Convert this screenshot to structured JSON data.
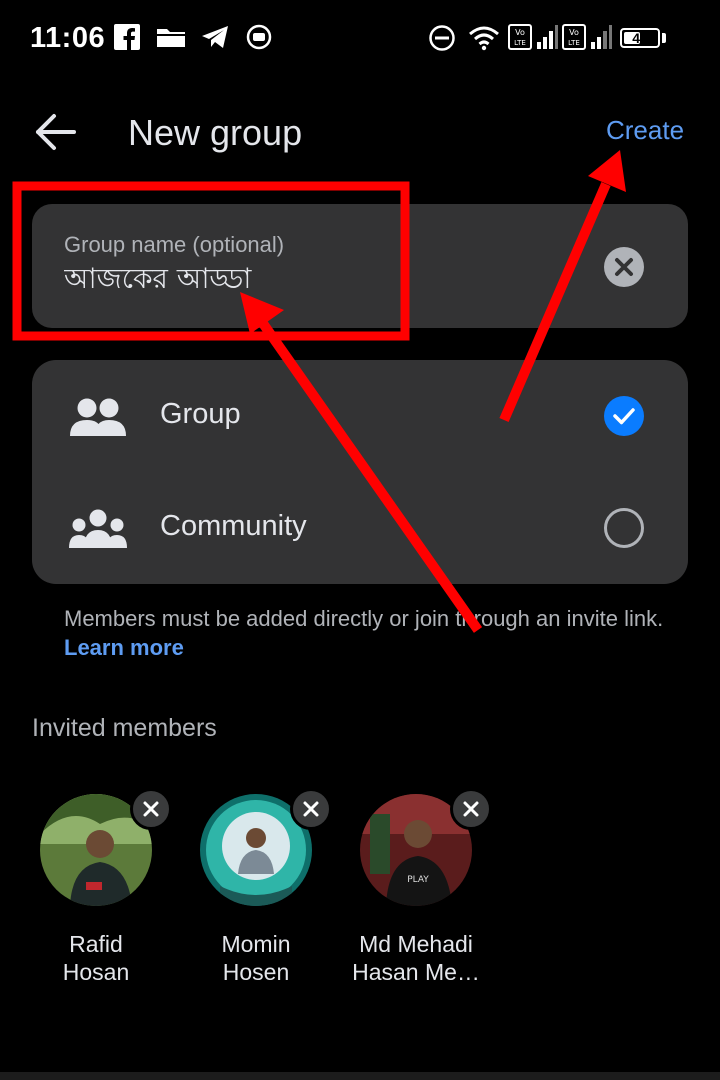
{
  "status_bar": {
    "time": "11:06",
    "battery": "49",
    "battery_level": 0.49,
    "icons": [
      "facebook-icon",
      "folder-icon",
      "telegram-icon",
      "record-icon",
      "do-not-disturb-icon",
      "wifi-icon",
      "volte-icon",
      "signal-icon",
      "volte-icon",
      "signal-icon",
      "battery-icon"
    ]
  },
  "header": {
    "title": "New group",
    "create_label": "Create"
  },
  "group_name": {
    "label": "Group name (optional)",
    "value": "আজকের আড্ডা"
  },
  "type_options": [
    {
      "label": "Group",
      "selected": true,
      "icon": "group-icon"
    },
    {
      "label": "Community",
      "selected": false,
      "icon": "community-icon"
    }
  ],
  "hint": {
    "text": "Members must be added directly or join through an invite link.",
    "link": "Learn more"
  },
  "invited_section_title": "Invited members",
  "members": [
    {
      "name_line1": "Rafid",
      "name_line2": "Hosan"
    },
    {
      "name_line1": "Momin",
      "name_line2": "Hosen"
    },
    {
      "name_line1": "Md Mehadi",
      "name_line2": "Hasan Me…"
    }
  ],
  "colors": {
    "accent": "#0a7cff",
    "link": "#5e9cf2",
    "card": "#333334",
    "annotation": "#ff0000"
  }
}
